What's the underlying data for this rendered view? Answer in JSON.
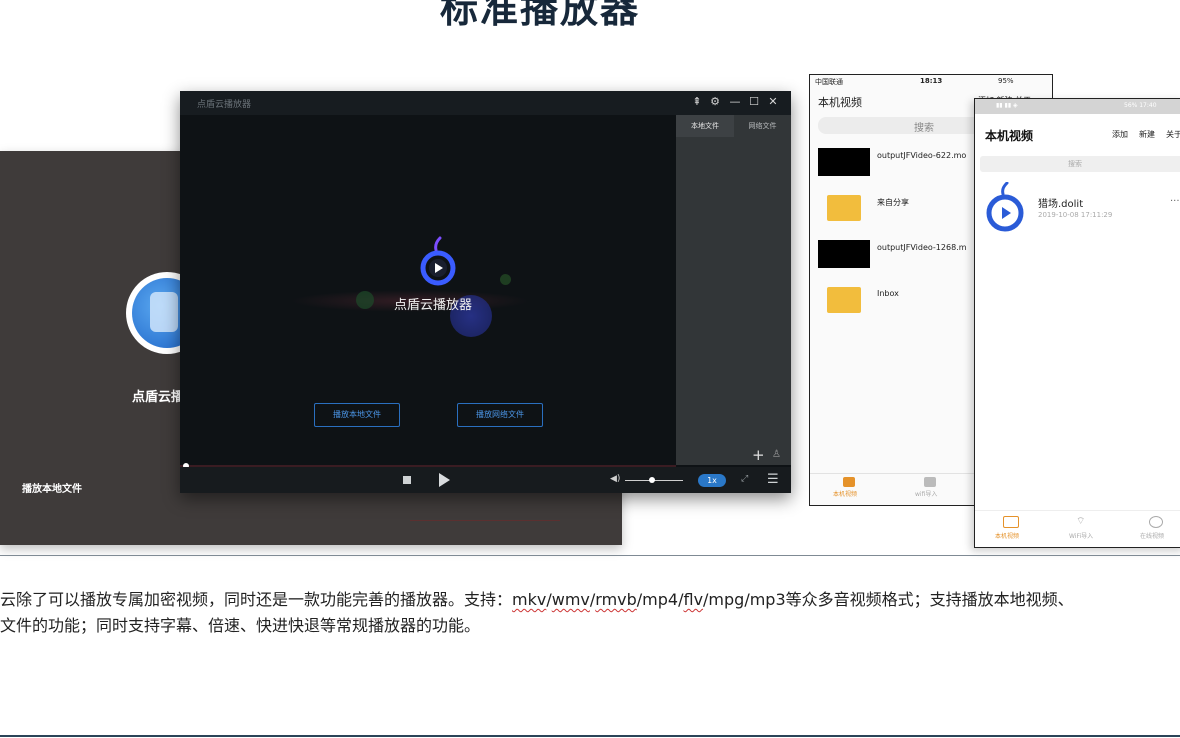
{
  "heading": "标准播放器",
  "background_window": {
    "app_name": "点盾云播",
    "play_local_label": "播放本地文件"
  },
  "player": {
    "window_title": "点盾云播放器",
    "title_buttons": {
      "pin": "⇞",
      "settings": "⚙",
      "minimize": "—",
      "maximize": "☐",
      "close": "✕"
    },
    "side_tabs": [
      "本地文件",
      "网络文件"
    ],
    "app_name": "点盾云播放器",
    "play_local_button": "播放本地文件",
    "play_network_button": "播放网络文件",
    "speed_label": "1x",
    "add_icon": "+",
    "playback_progress": 0.01,
    "volume_level": 0.47
  },
  "phone1": {
    "carrier": "中国联通",
    "time": "18:13",
    "battery": "95%",
    "title": "本机视频",
    "menu_text": "添加 新建 关于",
    "search_placeholder": "搜索",
    "items": [
      "outputJFVideo-622.mo",
      "来自分享",
      "outputJFVideo-1268.m",
      "Inbox"
    ],
    "tabs": [
      "本机视频",
      "wifi导入"
    ]
  },
  "phone2": {
    "status_right": "56% 17:40",
    "title": "本机视频",
    "actions": [
      "添加",
      "新建",
      "关于"
    ],
    "search_placeholder": "搜索",
    "file_name": "猎场.dolit",
    "file_date": "2019-10-08 17:11:29",
    "more": "···",
    "tabs": [
      "本机视频",
      "WiFi导入",
      "在线视频"
    ]
  },
  "description": {
    "line1_start": "云除了可以播放专属加密视频，同时还是一款功能完善的播放器。支持：",
    "formats": [
      "mkv",
      "wmv",
      "rmvb",
      "mp4",
      "flv",
      "mpg",
      "mp3"
    ],
    "line1_end": "等众多音视频格式；支持播放本地视频、",
    "line2": "文件的功能；同时支持字幕、倍速、快进快退等常规播放器的功能。"
  },
  "colors": {
    "accent_blue": "#2a78c8",
    "orange": "#e5922a",
    "player_bg": "#0e1215",
    "folder": "#f2bd3d"
  }
}
